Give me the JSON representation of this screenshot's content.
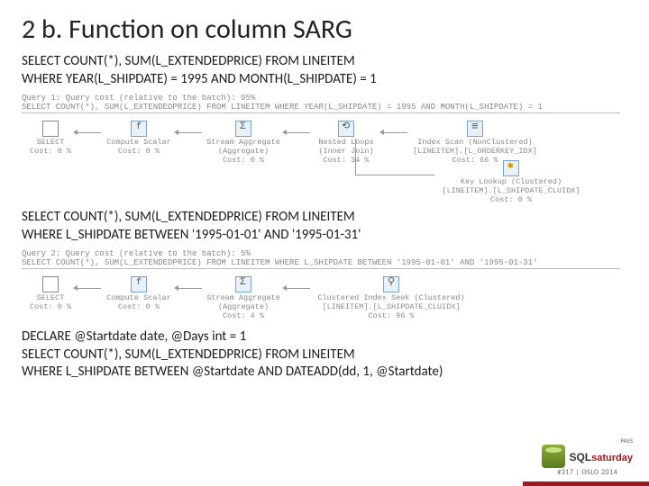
{
  "title": "2 b. Function on column SARG",
  "sql1_line1": "SELECT COUNT(*), SUM(L_EXTENDEDPRICE) FROM LINEITEM",
  "sql1_line2": "WHERE YEAR(L_SHIPDATE) = 1995 AND MONTH(L_SHIPDATE) = 1",
  "plan1_header": "Query 1: Query cost (relative to the batch): 95%",
  "plan1_sql": "SELECT COUNT(*), SUM(L_EXTENDEDPRICE) FROM LINEITEM WHERE YEAR(L_SHIPDATE) = 1995 AND MONTH(L_SHIPDATE) = 1",
  "plan1": {
    "select": {
      "label": "SELECT",
      "cost": "Cost: 0 %"
    },
    "scalar": {
      "label": "Compute Scalar",
      "cost": "Cost: 0 %"
    },
    "agg": {
      "label": "Stream Aggregate",
      "sub": "(Aggregate)",
      "cost": "Cost: 0 %"
    },
    "loop": {
      "label": "Nested Loops",
      "sub": "(Inner Join)",
      "cost": "Cost: 34 %"
    },
    "idx": {
      "label": "Index Scan (NonClustered)",
      "sub": "[LINEITEM].[L_ORDERKEY_IDX]",
      "cost": "Cost: 66 %"
    },
    "key": {
      "label": "Key Lookup (Clustered)",
      "sub": "[LINEITEM].[L_SHIPDATE_CLUIDX]",
      "cost": "Cost: 0 %"
    }
  },
  "sql2_line1": "SELECT COUNT(*), SUM(L_EXTENDEDPRICE) FROM LINEITEM",
  "sql2_line2": "WHERE L_SHIPDATE BETWEEN '1995-01-01' AND '1995-01-31'",
  "plan2_header": "Query 2: Query cost (relative to the batch): 5%",
  "plan2_sql": "SELECT COUNT(*), SUM(L_EXTENDEDPRICE) FROM LINEITEM WHERE L_SHIPDATE BETWEEN '1995-01-01' AND '1995-01-31'",
  "plan2": {
    "select": {
      "label": "SELECT",
      "cost": "Cost: 0 %"
    },
    "scalar": {
      "label": "Compute Scalar",
      "cost": "Cost: 0 %"
    },
    "agg": {
      "label": "Stream Aggregate",
      "sub": "(Aggregate)",
      "cost": "Cost: 4 %"
    },
    "seek": {
      "label": "Clustered Index Seek (Clustered)",
      "sub": "[LINEITEM].[L_SHIPDATE_CLUIDX]",
      "cost": "Cost: 96 %"
    }
  },
  "sql3_line1": "DECLARE @Startdate date, @Days int = 1",
  "sql3_line2": "SELECT COUNT(*), SUM(L_EXTENDEDPRICE) FROM LINEITEM",
  "sql3_line3": "WHERE L_SHIPDATE BETWEEN @Startdate  AND DATEADD(dd, 1, @Startdate)",
  "logo": {
    "top": "PASS",
    "brand1": "SQL",
    "brand2": "saturday",
    "sub": "#317 | OSLO 2014"
  }
}
